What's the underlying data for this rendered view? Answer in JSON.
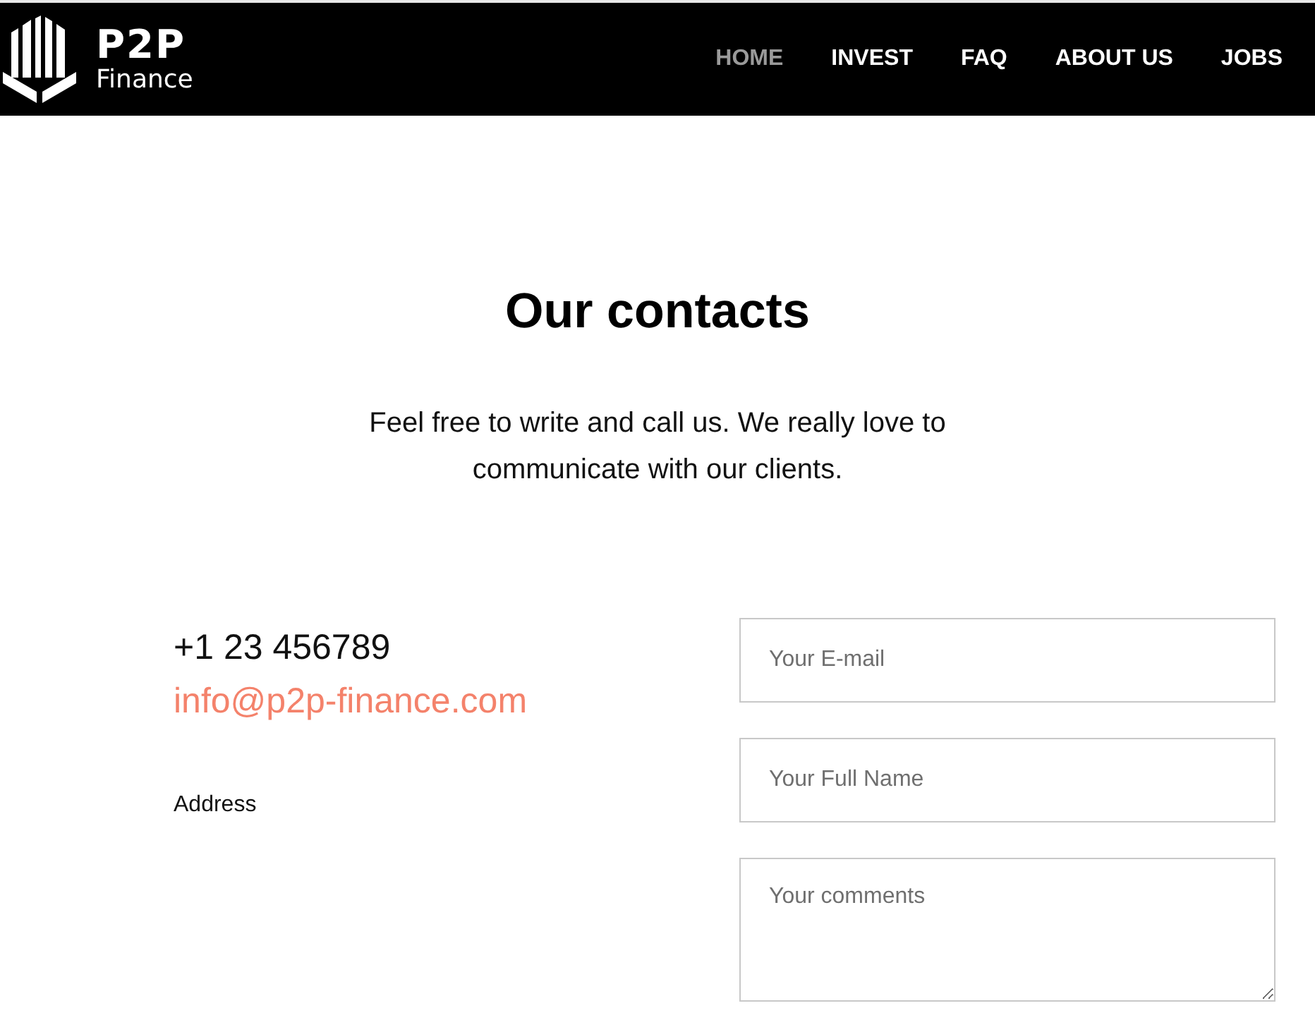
{
  "header": {
    "logo": {
      "title": "P2P",
      "subtitle": "Finance"
    },
    "nav": [
      {
        "label": "HOME",
        "selected": true
      },
      {
        "label": "INVEST",
        "selected": false
      },
      {
        "label": "FAQ",
        "selected": false
      },
      {
        "label": "ABOUT US",
        "selected": false
      },
      {
        "label": "JOBS",
        "selected": false
      }
    ]
  },
  "heading": "Our contacts",
  "intro": "Feel free to write and call us. We really love to communicate with our clients.",
  "contacts": {
    "phone": "+1 23 456789",
    "email": "info@p2p-finance.com",
    "address_label": "Address"
  },
  "form": {
    "fields": [
      {
        "kind": "input",
        "placeholder": "Your E-mail"
      },
      {
        "kind": "input",
        "placeholder": "Your Full Name"
      },
      {
        "kind": "textarea",
        "placeholder": "Your comments"
      }
    ]
  }
}
